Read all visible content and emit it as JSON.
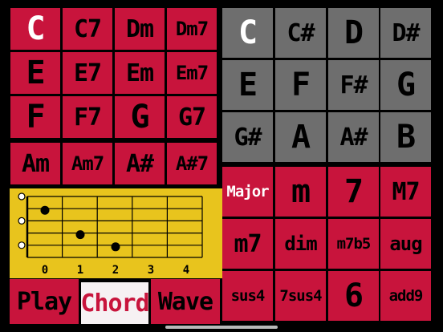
{
  "chord_grid": {
    "rows": [
      [
        "C",
        "C7",
        "Dm",
        "Dm7"
      ],
      [
        "E",
        "E7",
        "Em",
        "Em7"
      ],
      [
        "F",
        "F7",
        "G",
        "G7"
      ],
      [
        "Am",
        "Am7",
        "A#",
        "A#7"
      ]
    ],
    "selected": "C"
  },
  "root_keys": {
    "rows": [
      [
        "C",
        "C#",
        "D",
        "D#"
      ],
      [
        "E",
        "F",
        "F#",
        "G"
      ],
      [
        "G#",
        "A",
        "A#",
        "B"
      ]
    ],
    "selected": "C"
  },
  "chord_types": {
    "rows": [
      [
        "Major",
        "m",
        "7",
        "M7"
      ],
      [
        "m7",
        "dim",
        "m7b5",
        "aug"
      ],
      [
        "sus4",
        "7sus4",
        "6",
        "add9"
      ]
    ],
    "selected": "Major"
  },
  "fretboard": {
    "fret_labels": [
      "0",
      "1",
      "2",
      "3",
      "4"
    ],
    "strings": 6,
    "open_strings": [
      1,
      3,
      5
    ],
    "markers": [
      {
        "string": 2,
        "fret": 1
      },
      {
        "string": 4,
        "fret": 2
      },
      {
        "string": 5,
        "fret": 3
      }
    ]
  },
  "modes": {
    "play": "Play",
    "chord": "Chord",
    "wave": "Wave",
    "selected": "Chord"
  },
  "colors": {
    "red": "#c8143c",
    "gray": "#6e6e6e",
    "yellow": "#e8c41d"
  }
}
